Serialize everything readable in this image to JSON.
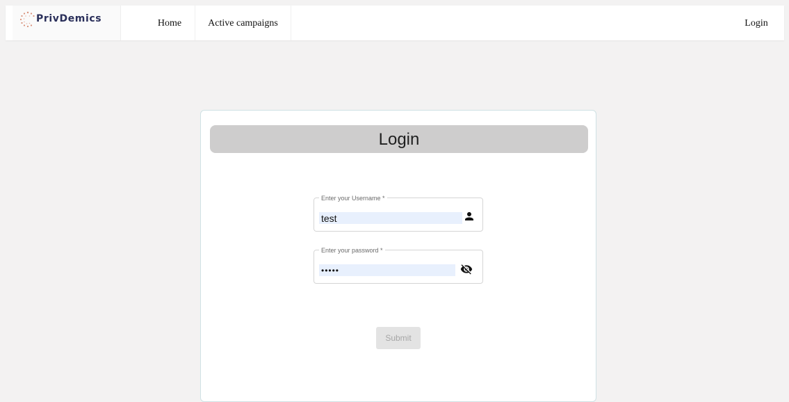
{
  "navbar": {
    "brand": "PrivDemics",
    "items": [
      {
        "label": "Home"
      },
      {
        "label": "Active campaigns"
      }
    ],
    "login_label": "Login"
  },
  "login_card": {
    "title": "Login",
    "username": {
      "label": "Enter your Username *",
      "value": "test",
      "icon": "person-icon"
    },
    "password": {
      "label": "Enter your password *",
      "value": "•••••",
      "icon": "eye-off-icon"
    },
    "submit_label": "Submit"
  },
  "colors": {
    "page_background": "#f3f2f2",
    "header_bar": "#cecdcd",
    "autofill_background": "#e8f0fd",
    "brand_text": "#2a2f5a",
    "submit_disabled": "#e3e3e3"
  }
}
